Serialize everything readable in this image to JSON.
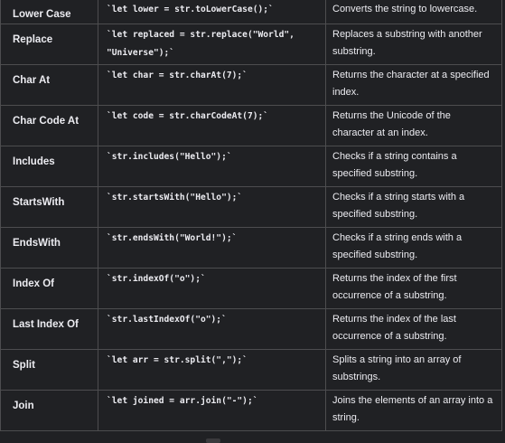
{
  "rows": [
    {
      "method": "Lower Case",
      "code": "`let lower = str.toLowerCase();`",
      "desc": "Converts the string to lowercase."
    },
    {
      "method": "Replace",
      "code": "`let replaced = str.replace(\"World\", \"Universe\");`",
      "desc": "Replaces a substring with another substring."
    },
    {
      "method": "Char At",
      "code": "`let char = str.charAt(7);`",
      "desc": "Returns the character at a specified index."
    },
    {
      "method": "Char Code At",
      "code": "`let code = str.charCodeAt(7);`",
      "desc": "Returns the Unicode of the character at an index."
    },
    {
      "method": "Includes",
      "code": "`str.includes(\"Hello\");`",
      "desc": "Checks if a string contains a specified substring."
    },
    {
      "method": "StartsWith",
      "code": "`str.startsWith(\"Hello\");`",
      "desc": "Checks if a string starts with a specified substring."
    },
    {
      "method": "EndsWith",
      "code": "`str.endsWith(\"World!\");`",
      "desc": "Checks if a string ends with a specified substring."
    },
    {
      "method": "Index Of",
      "code": "`str.indexOf(\"o\");`",
      "desc": "Returns the index of the first occurrence of a substring."
    },
    {
      "method": "Last Index Of",
      "code": "`str.lastIndexOf(\"o\");`",
      "desc": "Returns the index of the last occurrence of a substring."
    },
    {
      "method": "Split",
      "code": "`let arr = str.split(\",\");`",
      "desc": "Splits a string into an array of substrings."
    },
    {
      "method": "Join",
      "code": "`let joined = arr.join(\"-\");`",
      "desc": "Joins the elements of an array into a string."
    }
  ],
  "colors": {
    "background": "#202124",
    "border": "#4d4d4f",
    "text": "#ececf1"
  }
}
